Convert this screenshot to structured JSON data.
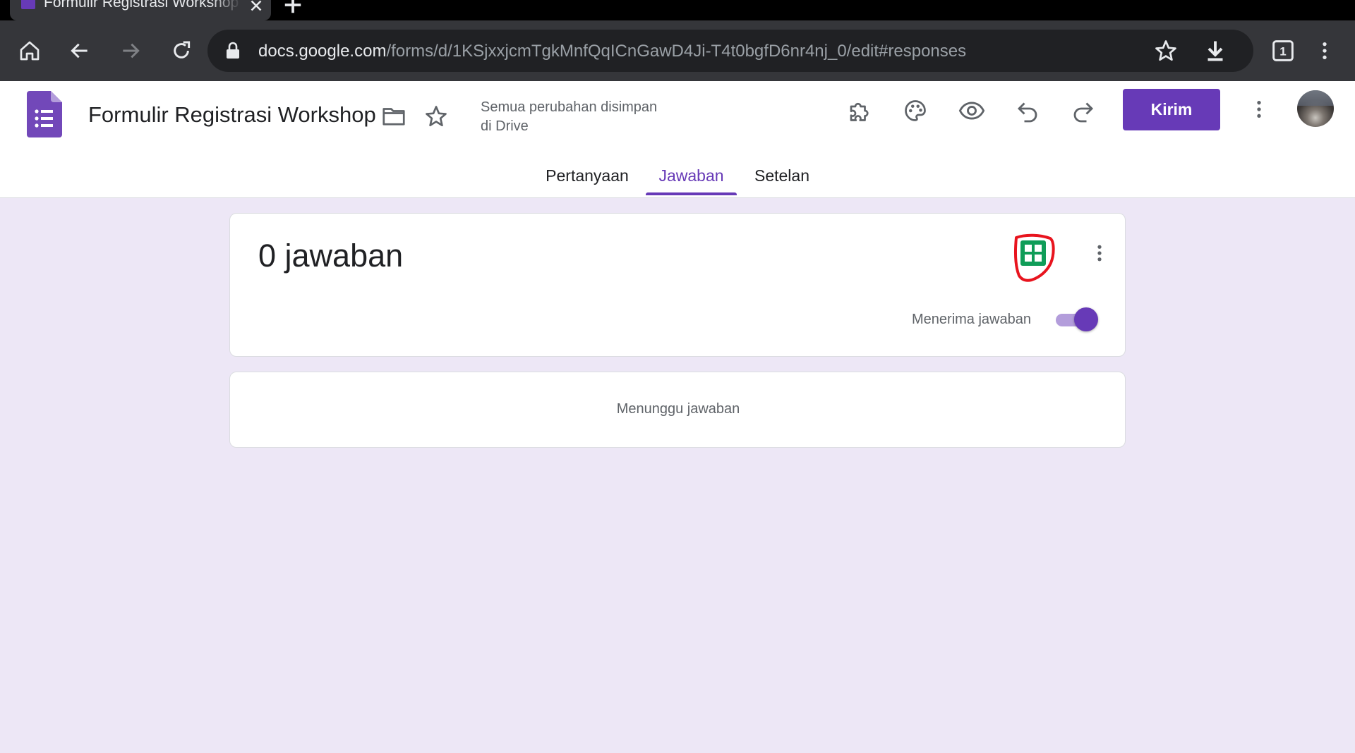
{
  "browser": {
    "tab_title": "Formulir Registrasi Workshop",
    "url_host": "docs.google.com",
    "url_path": "/forms/d/1KSjxxjcmTgkMnfQqICnGawD4Ji-T4t0bgfD6nr4nj_0/edit#responses",
    "tab_count": "1"
  },
  "header": {
    "title": "Formulir Registrasi Workshop",
    "save_status_line1": "Semua perubahan disimpan",
    "save_status_line2": "di Drive",
    "send_label": "Kirim"
  },
  "tabs": [
    {
      "label": "Pertanyaan",
      "active": false
    },
    {
      "label": "Jawaban",
      "active": true
    },
    {
      "label": "Setelan",
      "active": false
    }
  ],
  "responses": {
    "count_label": "0 jawaban",
    "accepting_label": "Menerima jawaban",
    "accepting": true,
    "waiting_label": "Menunggu jawaban"
  },
  "colors": {
    "accent": "#673ab7",
    "background": "#ede7f6",
    "sheets_green": "#0f9d58",
    "annotation_red": "#e8141e"
  }
}
